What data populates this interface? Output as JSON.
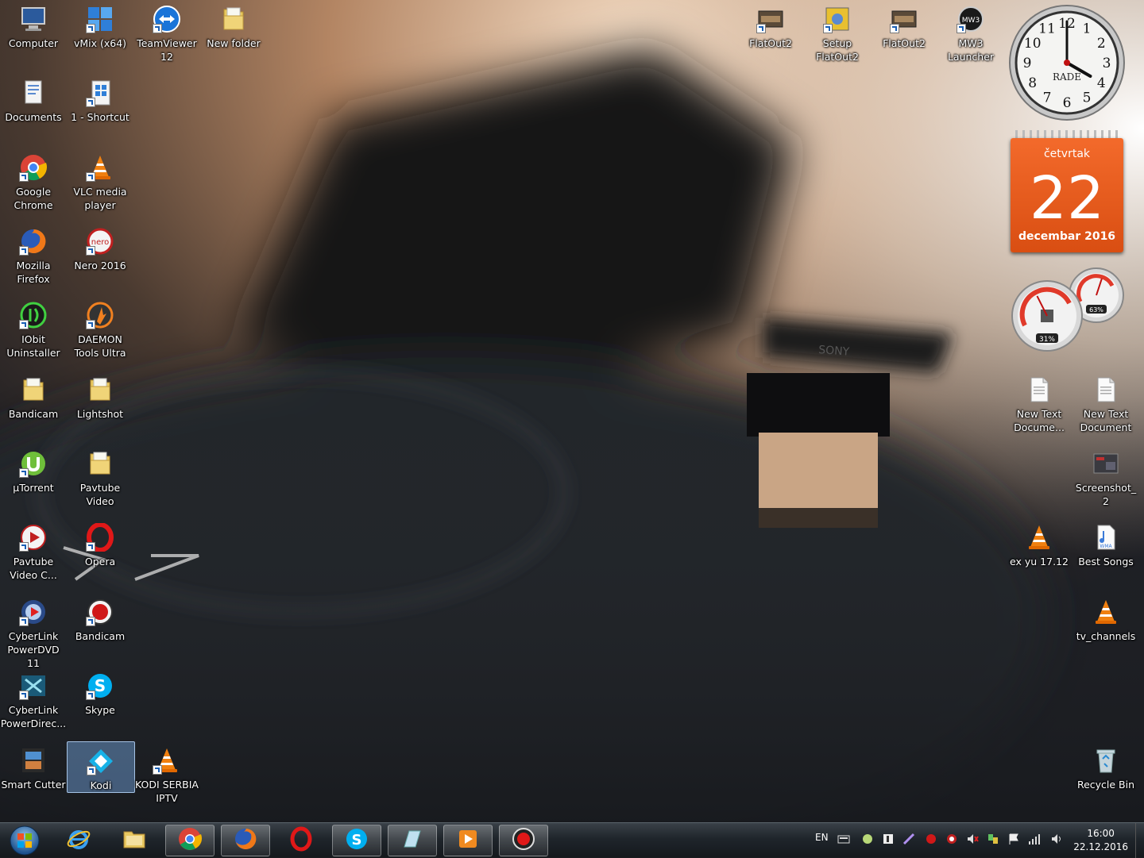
{
  "desktop": {
    "icons_left": [
      {
        "id": "computer",
        "label": "Computer",
        "icon": "computer-icon"
      },
      {
        "id": "vmix",
        "label": "vMix (x64)",
        "icon": "vmix-icon"
      },
      {
        "id": "teamviewer",
        "label": "TeamViewer\n12",
        "icon": "teamviewer-icon"
      },
      {
        "id": "new-folder",
        "label": "New folder",
        "icon": "folder-icon"
      },
      {
        "id": "documents",
        "label": "Documents",
        "icon": "documents-icon"
      },
      {
        "id": "shortcut-1",
        "label": "1 - Shortcut",
        "icon": "grid-icon"
      },
      {
        "id": "google-chrome",
        "label": "Google\nChrome",
        "icon": "chrome-icon"
      },
      {
        "id": "vlc",
        "label": "VLC media\nplayer",
        "icon": "vlc-cone-icon"
      },
      {
        "id": "firefox",
        "label": "Mozilla\nFirefox",
        "icon": "firefox-icon"
      },
      {
        "id": "nero",
        "label": "Nero 2016",
        "icon": "nero-icon"
      },
      {
        "id": "iobit",
        "label": "IObit\nUninstaller",
        "icon": "iobit-icon"
      },
      {
        "id": "daemon",
        "label": "DAEMON\nTools Ultra",
        "icon": "daemon-icon"
      },
      {
        "id": "bandicam-1",
        "label": "Bandicam",
        "icon": "folder-icon"
      },
      {
        "id": "lightshot",
        "label": "Lightshot",
        "icon": "folder-icon"
      },
      {
        "id": "utorrent",
        "label": "µTorrent",
        "icon": "utorrent-icon"
      },
      {
        "id": "pavtube-video",
        "label": "Pavtube\nVideo",
        "icon": "folder-icon"
      },
      {
        "id": "pavtube-video-c",
        "label": "Pavtube\nVideo C...",
        "icon": "pavtube-icon"
      },
      {
        "id": "opera",
        "label": "Opera",
        "icon": "opera-icon"
      },
      {
        "id": "powerdvd",
        "label": "CyberLink\nPowerDVD 11",
        "icon": "powerdvd-icon"
      },
      {
        "id": "bandicam-2",
        "label": "Bandicam",
        "icon": "bandicam-icon"
      },
      {
        "id": "powerdirector",
        "label": "CyberLink\nPowerDirec...",
        "icon": "powerdirector-icon"
      },
      {
        "id": "skype",
        "label": "Skype",
        "icon": "skype-icon"
      },
      {
        "id": "smart-cutter",
        "label": "Smart Cutter",
        "icon": "film-icon"
      },
      {
        "id": "kodi",
        "label": "Kodi",
        "icon": "kodi-icon"
      },
      {
        "id": "kodi-serbia",
        "label": "KODI SERBIA\nIPTV",
        "icon": "vlc-cone-icon"
      }
    ],
    "icons_right": [
      {
        "id": "flatout2-a",
        "label": "FlatOut2",
        "icon": "flatout-icon"
      },
      {
        "id": "setup-flatout2",
        "label": "Setup\nFlatOut2",
        "icon": "setup-icon"
      },
      {
        "id": "flatout2-b",
        "label": "FlatOut2",
        "icon": "flatout-icon"
      },
      {
        "id": "mw3",
        "label": "MW3\nLauncher",
        "icon": "mw3-icon"
      },
      {
        "id": "new-text-1",
        "label": "New Text\nDocume...",
        "icon": "text-file-icon"
      },
      {
        "id": "new-text-2",
        "label": "New Text\nDocument",
        "icon": "text-file-icon"
      },
      {
        "id": "screenshot2",
        "label": "Screenshot_2",
        "icon": "image-file-icon"
      },
      {
        "id": "exyu",
        "label": "ex yu 17.12",
        "icon": "vlc-cone-icon"
      },
      {
        "id": "best-songs",
        "label": "Best Songs",
        "icon": "wma-file-icon"
      },
      {
        "id": "tv-channels",
        "label": "tv_channels",
        "icon": "vlc-cone-icon"
      },
      {
        "id": "recycle-bin",
        "label": "Recycle Bin",
        "icon": "recycle-bin-icon"
      }
    ]
  },
  "clock_gadget": {
    "name": "RADE",
    "time": "16:00",
    "numbers": [
      "12",
      "1",
      "2",
      "3",
      "4",
      "5",
      "6",
      "7",
      "8",
      "9",
      "10",
      "11"
    ]
  },
  "calendar_gadget": {
    "weekday": "četvrtak",
    "day": "22",
    "month_year": "decembar 2016"
  },
  "meter_gadget": {
    "cpu_percent": "31%",
    "mem_percent": "63%",
    "cpu": 31,
    "mem": 63
  },
  "taskbar": {
    "pinned": [
      "internet-explorer-icon",
      "explorer-folder-icon",
      "chrome-icon",
      "firefox-icon",
      "opera-icon",
      "skype-icon",
      "screen-tool-icon",
      "media-player-icon",
      "record-icon"
    ],
    "tray": {
      "language": "EN",
      "time": "16:00",
      "date": "22.12.2016"
    }
  },
  "colors": {
    "accent": "#e8581a",
    "taskbar": "#1f252b"
  }
}
